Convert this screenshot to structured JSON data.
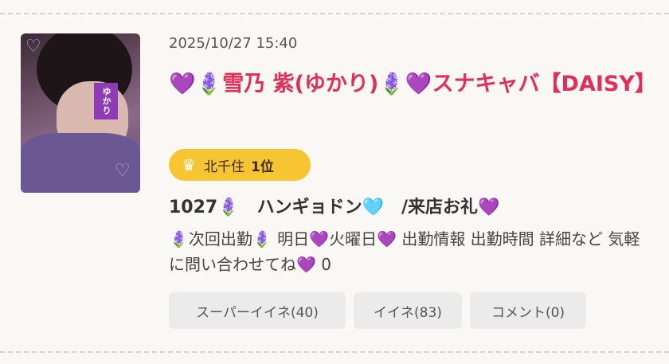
{
  "post": {
    "date": "2025/10/27 15:40",
    "title": "💜🪻雪乃 紫(ゆかり)🪻💜スナキャバ【DAISY】",
    "thumbnail_tag": "ゆかり",
    "rank": {
      "area": "北千住",
      "position": "1位"
    },
    "subject": "1027🪻　ハンギョドン🩵　/来店お礼💜",
    "body": "🪻次回出勤🪻 明日💜火曜日💜 出勤情報 出勤時間 詳細など 気軽に問い合わせてね💜 0",
    "actions": {
      "super_like": "スーパーイイネ(40)",
      "like": "イイネ(83)",
      "comment": "コメント(0)"
    }
  },
  "colors": {
    "title": "#e0305a",
    "rank_badge": "#f7c531",
    "button_bg": "#ebebeb",
    "background": "#faf8f5"
  },
  "icons": {
    "crown": "crown-icon",
    "heart": "heart-icon"
  }
}
